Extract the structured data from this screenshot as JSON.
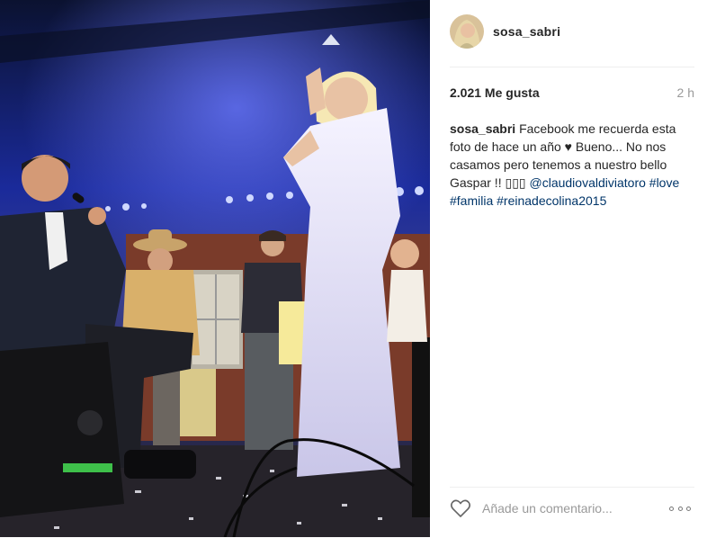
{
  "post": {
    "username": "sosa_sabri",
    "likes": "2.021 Me gusta",
    "time_ago": "2 h",
    "caption": {
      "username": "sosa_sabri",
      "text_1": "Facebook me recuerda esta foto de hace un año",
      "heart_glyph": "♥",
      "text_2": "Bueno... No nos casamos pero tenemos a nuestro bello Gaspar !!",
      "emojis": "▯▯▯",
      "mention": "@claudiovaldiviatoro",
      "hashtag_1": "#love",
      "hashtag_2": "#familia",
      "hashtag_3": "#reinadecolina2015"
    },
    "comment_placeholder": "Añade un comentario...",
    "icons": {
      "like": "heart-outline-icon",
      "options": "more-dots-icon"
    }
  }
}
